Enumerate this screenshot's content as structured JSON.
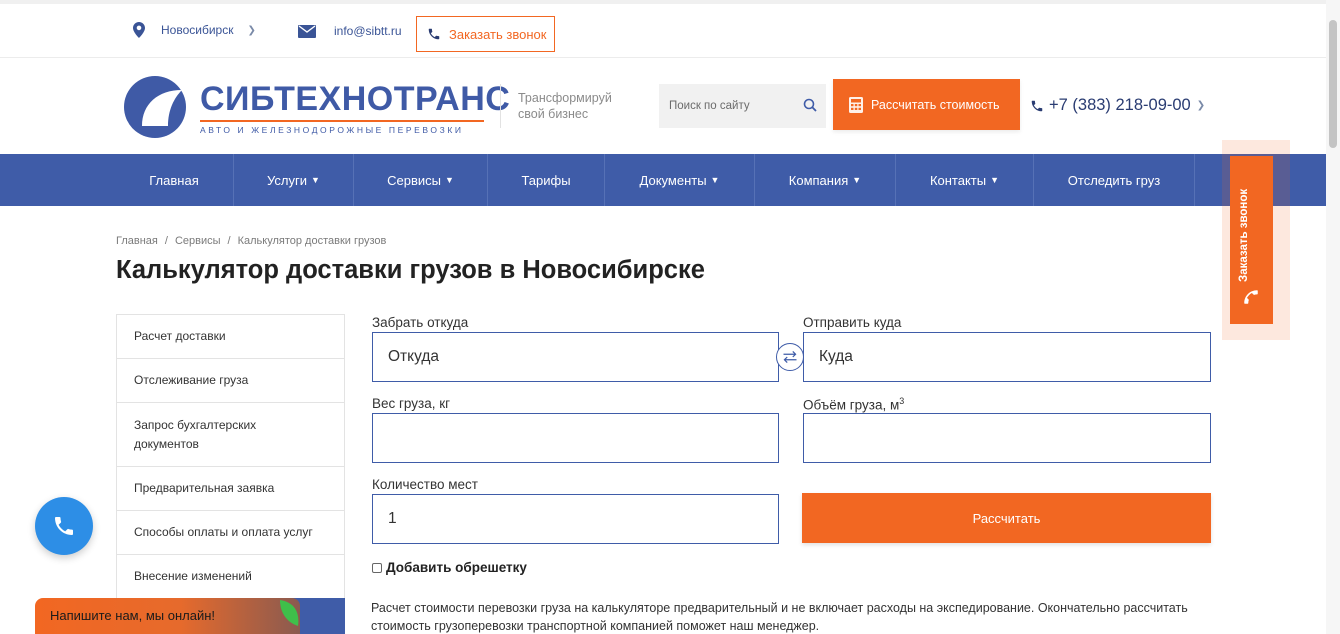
{
  "topbar": {
    "city": "Новосибирск",
    "email": "info@sibtt.ru",
    "callback_label": "Заказать звонок"
  },
  "header": {
    "logo_name": "СИБТЕХНОТРАНС",
    "logo_tagline": "АВТО И ЖЕЛЕЗНОДОРОЖНЫЕ ПЕРЕВОЗКИ",
    "slogan_line1": "Трансформируй",
    "slogan_line2": "свой бизнес",
    "search_placeholder": "Поиск по сайту",
    "calc_button": "Рассчитать стоимость",
    "phone": "+7 (383) 218-09-00"
  },
  "nav": {
    "items": [
      {
        "label": "Главная",
        "dropdown": false
      },
      {
        "label": "Услуги",
        "dropdown": true
      },
      {
        "label": "Сервисы",
        "dropdown": true
      },
      {
        "label": "Тарифы",
        "dropdown": false
      },
      {
        "label": "Документы",
        "dropdown": true
      },
      {
        "label": "Компания",
        "dropdown": true
      },
      {
        "label": "Контакты",
        "dropdown": true
      },
      {
        "label": "Отследить груз",
        "dropdown": false
      }
    ]
  },
  "side_callback": {
    "label": "Заказать звонок"
  },
  "breadcrumb": {
    "home": "Главная",
    "section": "Сервисы",
    "current": "Калькулятор доставки грузов",
    "separator": "/"
  },
  "page_title": "Калькулятор доставки грузов в Новосибирске",
  "left_menu": {
    "items": [
      "Расчет доставки",
      "Отслеживание груза",
      "Запрос бухгалтерских документов",
      "Предварительная заявка",
      "Способы оплаты и оплата услуг",
      "Внесение изменений"
    ]
  },
  "form": {
    "from_label": "Забрать откуда",
    "from_placeholder": "Откуда",
    "to_label": "Отправить куда",
    "to_placeholder": "Куда",
    "weight_label": "Вес груза, кг",
    "weight_value": "",
    "volume_label": "Объём груза, м",
    "volume_unit_sup": "3",
    "volume_value": "",
    "places_label": "Количество мест",
    "places_value": "1",
    "submit_label": "Рассчитать",
    "crate_label": "Добавить обрешетку",
    "note": "Расчет стоимости перевозки груза на калькуляторе предварительный и не включает расходы на экспедирование. Окончательно рассчитать стоимость грузоперевозки транспортной компанией поможет наш менеджер."
  },
  "chat": {
    "label": "Напишите нам, мы онлайн!"
  },
  "colors": {
    "brand_blue": "#3f5ca8",
    "accent_orange": "#f26722",
    "call_blue": "#2d8ee6"
  }
}
